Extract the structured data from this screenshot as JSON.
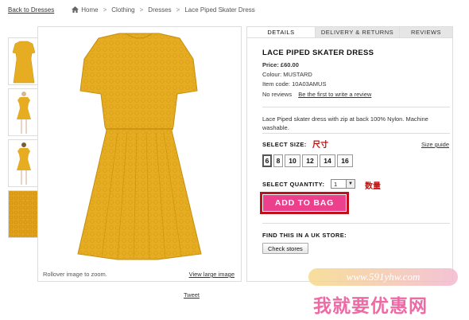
{
  "breadcrumb": {
    "back": "Back to Dresses",
    "items": [
      "Home",
      "Clothing",
      "Dresses",
      "Lace Piped Skater Dress"
    ],
    "separator": ">"
  },
  "gallery": {
    "caption": "Rollover image to zoom.",
    "view_large": "View large image",
    "dress_color": "#e6ad22"
  },
  "tweet": "Tweet",
  "tabs": [
    "DETAILS",
    "DELIVERY & RETURNS",
    "REVIEWS"
  ],
  "product": {
    "name": "LACE PIPED SKATER DRESS",
    "price": "Price: £60.00",
    "colour": "Colour: MUSTARD",
    "item_code": "Item code: 10A03AMUS",
    "reviews": "No reviews",
    "write_review": "Be the first to write a review",
    "description": "Lace Piped skater dress with zip at back 100% Nylon. Machine washable."
  },
  "size": {
    "label": "SELECT SIZE:",
    "annotation": "尺寸",
    "guide": "Size guide",
    "options": [
      "6",
      "8",
      "10",
      "12",
      "14",
      "16"
    ],
    "selected": "6"
  },
  "quantity": {
    "label": "SELECT QUANTITY:",
    "value": "1",
    "annotation": "数量"
  },
  "add_to_bag": "ADD TO BAG",
  "store": {
    "label": "FIND THIS IN A UK STORE:",
    "button": "Check stores"
  },
  "watermark": {
    "url": "www.591yhw.com",
    "text": "我就要优惠网"
  },
  "colors": {
    "accent_pink": "#ec3f8c",
    "annotation_red": "#c01010",
    "dress_mustard": "#e6ad22"
  }
}
